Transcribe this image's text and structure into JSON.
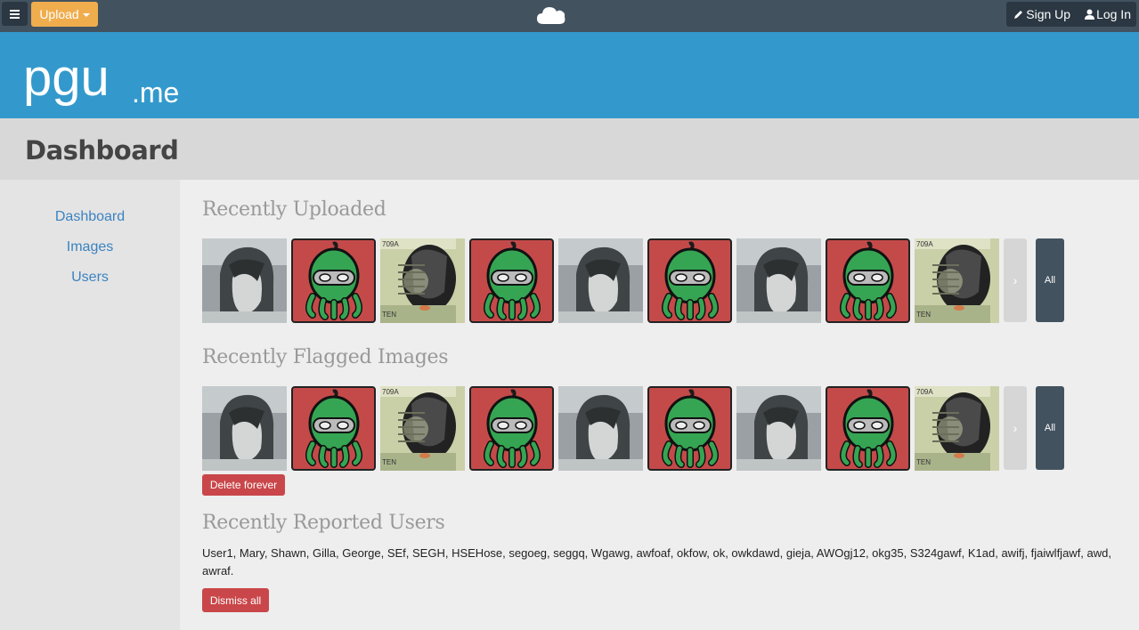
{
  "navbar": {
    "upload_label": "Upload",
    "signup_label": "Sign Up",
    "login_label": "Log In"
  },
  "brand": {
    "logo_text": "pgu",
    "logo_suffix": ".me"
  },
  "page_title": "Dashboard",
  "sidebar": {
    "items": [
      {
        "label": "Dashboard"
      },
      {
        "label": "Images"
      },
      {
        "label": "Users"
      }
    ]
  },
  "sections": {
    "uploaded_title": "Recently Uploaded",
    "flagged_title": "Recently Flagged Images",
    "reported_title": "Recently Reported Users",
    "all_label": "All",
    "delete_label": "Delete forever",
    "dismiss_label": "Dismiss all",
    "reported_users": "User1, Mary, Shawn, Gilla, George, SEf, SEGH, HSEHose, segoeg, seggq, Wgawg, awfoaf, okfow, ok, owkdawd, gieja, AWOgj12, okg35, S324gawf, K1ad, awifj, fjaiwlfjawf, awd, awraf."
  },
  "thumbnails": [
    "anime-girl",
    "green-octopus",
    "dollar-bill",
    "green-octopus",
    "anime-girl",
    "green-octopus",
    "anime-girl",
    "green-octopus",
    "dollar-bill"
  ],
  "colors": {
    "navbar": "#43525f",
    "brand": "#3399cc",
    "upload": "#f0ad4e",
    "danger": "#c9474a",
    "link": "#3b83c0"
  }
}
